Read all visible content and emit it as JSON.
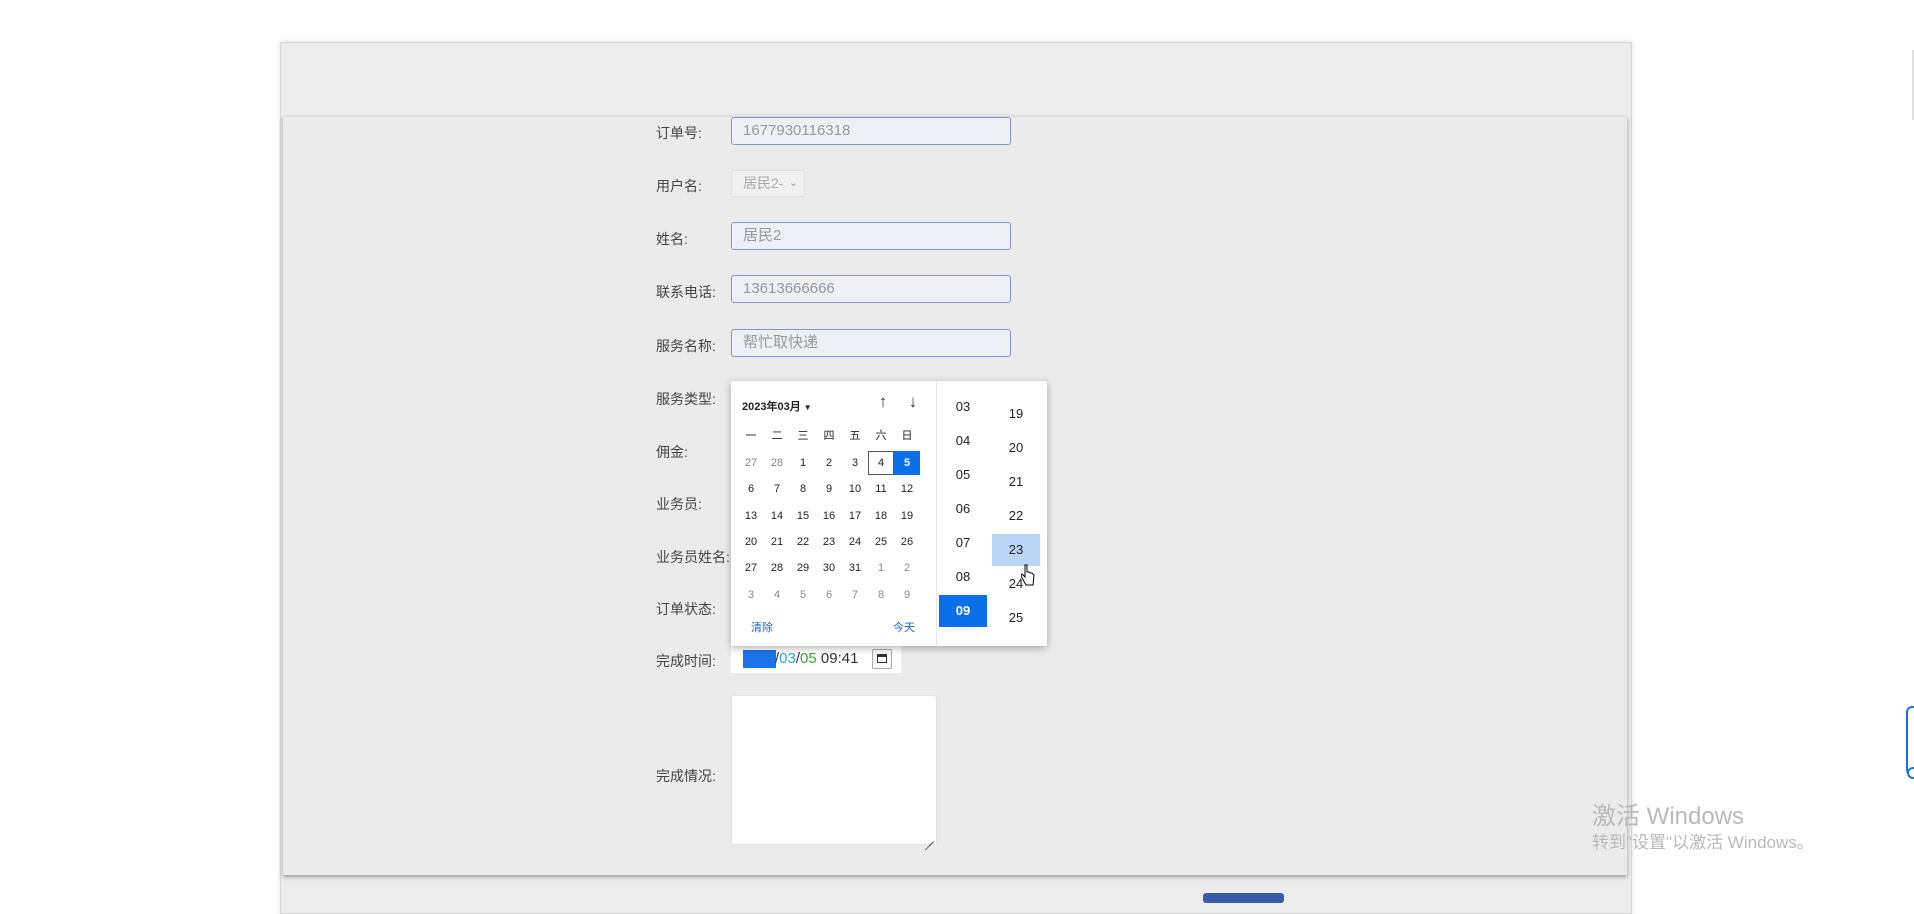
{
  "form": {
    "labels": {
      "order_no": "订单号:",
      "username": "用户名:",
      "name": "姓名:",
      "phone": "联系电话:",
      "service_name": "服务名称:",
      "service_type": "服务类型:",
      "commission": "佣金:",
      "staff": "业务员:",
      "staff_name": "业务员姓名:",
      "order_status": "订单状态:",
      "finish_time": "完成时间:",
      "finish_situation": "完成情况:"
    },
    "values": {
      "order_no": "1677930116318",
      "username": "居民2-",
      "name": "居民2",
      "phone": "13613666666",
      "service_name": "帮忙取快递"
    },
    "finish_time": {
      "year": "2023",
      "month": "03",
      "day": "05",
      "time": "09:41"
    }
  },
  "picker": {
    "month_title": "2023年03月",
    "weekdays": [
      "一",
      "二",
      "三",
      "四",
      "五",
      "六",
      "日"
    ],
    "weeks": [
      [
        "27",
        "28",
        "1",
        "2",
        "3",
        "4",
        "5"
      ],
      [
        "6",
        "7",
        "8",
        "9",
        "10",
        "11",
        "12"
      ],
      [
        "13",
        "14",
        "15",
        "16",
        "17",
        "18",
        "19"
      ],
      [
        "20",
        "21",
        "22",
        "23",
        "24",
        "25",
        "26"
      ],
      [
        "27",
        "28",
        "29",
        "30",
        "31",
        "1",
        "2"
      ],
      [
        "3",
        "4",
        "5",
        "6",
        "7",
        "8",
        "9"
      ]
    ],
    "today": "4",
    "selected": "5",
    "clear_label": "清除",
    "today_label": "今天",
    "hours": [
      "03",
      "04",
      "05",
      "06",
      "07",
      "08",
      "09"
    ],
    "selected_hour": "09",
    "minutes": [
      "19",
      "20",
      "21",
      "22",
      "23",
      "24",
      "25"
    ],
    "hover_minute": "23"
  },
  "watermark": {
    "line1": "激活 Windows",
    "line2": "转到\"设置\"以激活 Windows。"
  },
  "colors": {
    "accent": "#0a6fe8",
    "hover": "#b9d6f7",
    "input_border": "#8a94c4"
  }
}
